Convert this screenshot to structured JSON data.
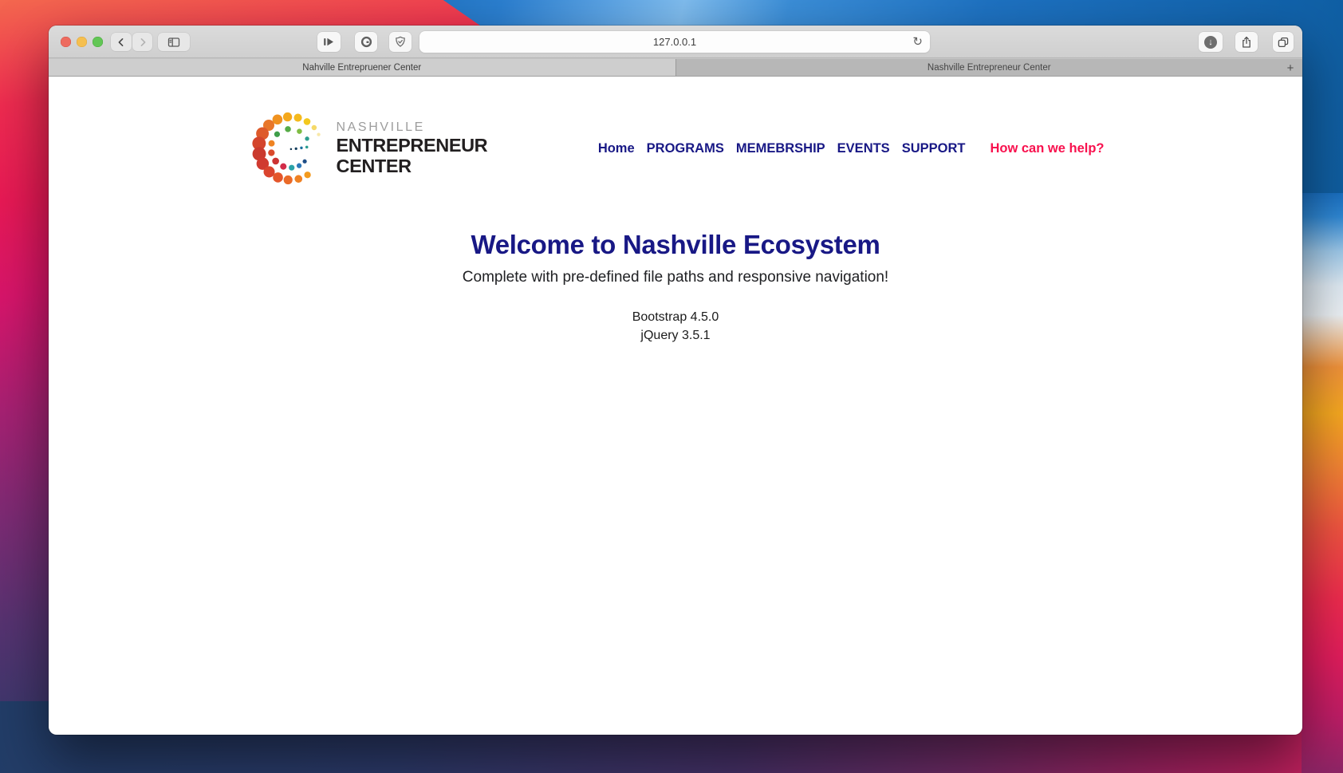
{
  "browser": {
    "toolbar": {
      "url": "127.0.0.1"
    },
    "tabs": [
      {
        "title": "Nahville Entrepruener Center",
        "active": true
      },
      {
        "title": "Nashville Entrepreneur Center",
        "active": false
      }
    ],
    "new_tab_label": "+"
  },
  "page": {
    "logo": {
      "word1": "NASHVILLE",
      "word2": "ENTREPRENEUR",
      "word3": "CENTER"
    },
    "nav": {
      "items": [
        "Home",
        "PROGRAMS",
        "MEMEBRSHIP",
        "EVENTS",
        "SUPPORT"
      ],
      "cta": "How can we help?"
    },
    "hero": {
      "title": "Welcome to Nashville Ecosystem",
      "subtitle": "Complete with pre-defined file paths and responsive navigation!",
      "stack": [
        "Bootstrap 4.5.0",
        "jQuery 3.5.1"
      ]
    },
    "colors": {
      "nav_link": "#181885",
      "title": "#181885",
      "cta": "#f8114e",
      "logo_palette": [
        "#d4452c",
        "#ef9020",
        "#f3c81e",
        "#56ab47",
        "#2aa2a8",
        "#2e79ba"
      ]
    }
  }
}
